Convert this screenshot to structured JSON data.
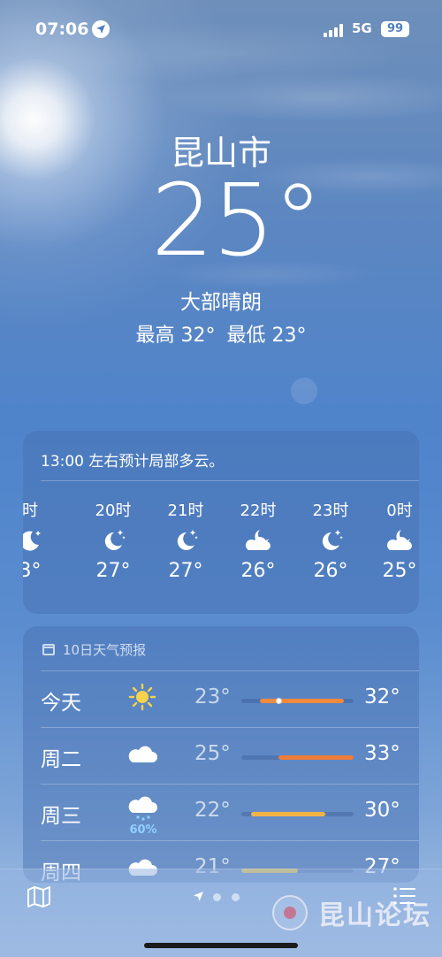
{
  "status_bar": {
    "time": "07:06",
    "network": "5G",
    "battery": "99",
    "location_icon": "location-arrow-icon",
    "signal_icon": "signal-bars-icon"
  },
  "header": {
    "city": "昆山市",
    "temperature": "25°",
    "condition": "大部晴朗",
    "high": "最高 32°",
    "low": "最低 23°"
  },
  "hourly": {
    "note": "13:00 左右预计局部多云。",
    "hours": [
      {
        "label": "时",
        "icon": "moon-stars-icon",
        "temp": "3°"
      },
      {
        "label": "20时",
        "icon": "moon-stars-icon",
        "temp": "27°"
      },
      {
        "label": "21时",
        "icon": "moon-stars-icon",
        "temp": "27°"
      },
      {
        "label": "22时",
        "icon": "moon-cloud-icon",
        "temp": "26°"
      },
      {
        "label": "23时",
        "icon": "moon-stars-icon",
        "temp": "26°"
      },
      {
        "label": "0时",
        "icon": "moon-cloud-icon",
        "temp": "25°"
      }
    ]
  },
  "daily": {
    "title": "10日天气预报",
    "range_min": 21,
    "range_max": 33,
    "days": [
      {
        "day": "今天",
        "icon": "sun-icon",
        "precip": "",
        "low": "23°",
        "high": "32°",
        "low_val": 23,
        "high_val": 32,
        "current": 25,
        "color": "#ef8a3f"
      },
      {
        "day": "周二",
        "icon": "cloud-icon",
        "precip": "",
        "low": "25°",
        "high": "33°",
        "low_val": 25,
        "high_val": 33,
        "color": "#ee7b3a"
      },
      {
        "day": "周三",
        "icon": "rain-cloud-icon",
        "precip": "60%",
        "low": "22°",
        "high": "30°",
        "low_val": 22,
        "high_val": 30,
        "color": "#f2b246"
      },
      {
        "day": "周四",
        "icon": "cloud-icon",
        "precip": "",
        "low": "21°",
        "high": "27°",
        "low_val": 21,
        "high_val": 27,
        "color": "#f0c84a"
      }
    ]
  },
  "bottom_bar": {
    "map_icon": "map-icon",
    "list_icon": "list-icon",
    "page_count": 2
  },
  "watermark": {
    "text": "昆山论坛"
  }
}
